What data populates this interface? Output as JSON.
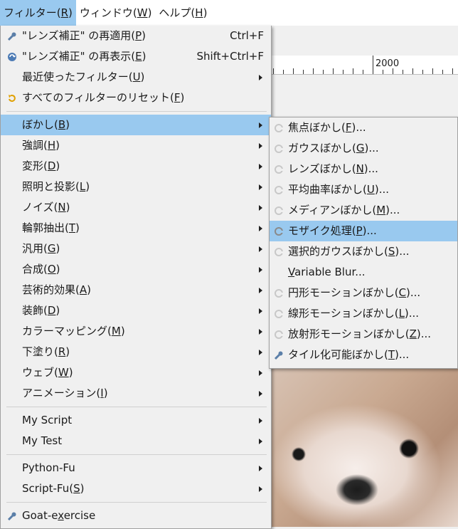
{
  "menubar": {
    "items": [
      {
        "label": "フィルター(",
        "key": "R",
        "suffix": ")"
      },
      {
        "label": "ウィンドウ(",
        "key": "W",
        "suffix": ")"
      },
      {
        "label": "ヘルプ(",
        "key": "H",
        "suffix": ")"
      }
    ]
  },
  "ruler": {
    "label": "2000"
  },
  "filter_menu": {
    "reapply": {
      "label": "\"レンズ補正\" の再適用(",
      "key": "P",
      "suffix": ")",
      "shortcut": "Ctrl+F",
      "icon": "gear-icon"
    },
    "reshow": {
      "label": "\"レンズ補正\" の再表示(",
      "key": "E",
      "suffix": ")",
      "shortcut": "Shift+Ctrl+F",
      "icon": "recycle-icon"
    },
    "recent": {
      "label": "最近使ったフィルター(",
      "key": "U",
      "suffix": ")"
    },
    "reset": {
      "label": "すべてのフィルターのリセット(",
      "key": "F",
      "suffix": ")",
      "icon": "reset-icon"
    },
    "blur": {
      "label": "ぼかし(",
      "key": "B",
      "suffix": ")"
    },
    "enhance": {
      "label": "強調(",
      "key": "H",
      "suffix": ")"
    },
    "distorts": {
      "label": "変形(",
      "key": "D",
      "suffix": ")"
    },
    "light_shadow": {
      "label": "照明と投影(",
      "key": "L",
      "suffix": ")"
    },
    "noise": {
      "label": "ノイズ(",
      "key": "N",
      "suffix": ")"
    },
    "edge_detect": {
      "label": "輪郭抽出(",
      "key": "T",
      "suffix": ")"
    },
    "generic": {
      "label": "汎用(",
      "key": "G",
      "suffix": ")"
    },
    "combine": {
      "label": "合成(",
      "key": "O",
      "suffix": ")"
    },
    "artistic": {
      "label": "芸術的効果(",
      "key": "A",
      "suffix": ")"
    },
    "decor": {
      "label": "装飾(",
      "key": "D",
      "suffix": ")"
    },
    "map": {
      "label": "カラーマッピング(",
      "key": "M",
      "suffix": ")"
    },
    "render": {
      "label": "下塗り(",
      "key": "R",
      "suffix": ")"
    },
    "web": {
      "label": "ウェブ(",
      "key": "W",
      "suffix": ")"
    },
    "animation": {
      "label": "アニメーション(",
      "key": "I",
      "suffix": ")"
    },
    "my_script": {
      "label": "My Script"
    },
    "my_test": {
      "label": "My Test"
    },
    "python_fu": {
      "label": "Python-Fu"
    },
    "script_fu": {
      "label": "Script-Fu(",
      "key": "S",
      "suffix": ")"
    },
    "goat": {
      "label_pre": "Goat-e",
      "key": "x",
      "label_post": "ercise",
      "icon": "gear-icon"
    }
  },
  "blur_submenu": {
    "items": [
      {
        "pre": "焦点ぼかし(",
        "key": "F",
        "post": ")..."
      },
      {
        "pre": "ガウスぼかし(",
        "key": "G",
        "post": ")..."
      },
      {
        "pre": "レンズぼかし(",
        "key": "N",
        "post": ")..."
      },
      {
        "pre": "平均曲率ぼかし(",
        "key": "U",
        "post": ")..."
      },
      {
        "pre": "メディアンぼかし(",
        "key": "M",
        "post": ")..."
      },
      {
        "pre": "モザイク処理(",
        "key": "P",
        "post": ")..."
      },
      {
        "pre": "選択的ガウスぼかし(",
        "key": "S",
        "post": ")..."
      },
      {
        "pre": "",
        "key": "V",
        "post": "ariable Blur..."
      },
      {
        "pre": "円形モーションぼかし(",
        "key": "C",
        "post": ")..."
      },
      {
        "pre": "線形モーションぼかし(",
        "key": "L",
        "post": ")..."
      },
      {
        "pre": "放射形モーションぼかし(",
        "key": "Z",
        "post": ")..."
      },
      {
        "pre": "タイル化可能ぼかし(",
        "key": "T",
        "post": ")..."
      }
    ]
  }
}
